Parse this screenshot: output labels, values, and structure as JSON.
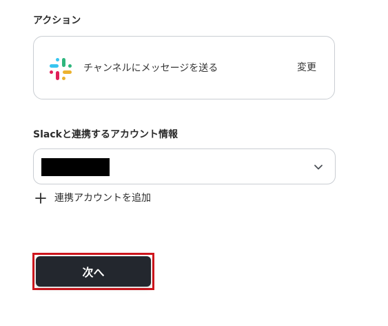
{
  "action_section": {
    "label": "アクション",
    "app_icon": "slack-icon",
    "action_title": "チャンネルにメッセージを送る",
    "change_label": "変更"
  },
  "account_section": {
    "label": "Slackと連携するアカウント情報",
    "selected_value": "",
    "value_redacted": true,
    "dropdown_icon": "chevron-down-icon",
    "add_account_icon": "plus-icon",
    "add_account_label": "連携アカウントを追加"
  },
  "footer": {
    "next_label": "次へ",
    "highlight_color": "#d0161d",
    "button_color": "#23272e"
  }
}
